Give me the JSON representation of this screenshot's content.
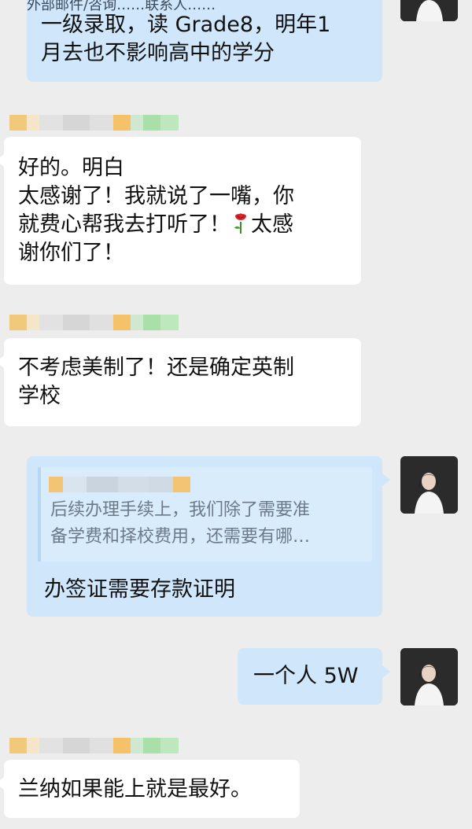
{
  "messages": {
    "m1": {
      "lines": [
        "一级录取，读 Grade8，明年1",
        "月去也不影响高中的学分"
      ],
      "top_fragment": "外部邮件/咨询……联系人……"
    },
    "m2": {
      "lines": [
        "好的。明白",
        "太感谢了！我就说了一嘴，你",
        "就费心帮我去打听了！",
        "谢你们了！"
      ],
      "line3_after_emoji": "太感",
      "emoji": "rose"
    },
    "m3": {
      "lines": [
        "不考虑美制了！还是确定英制",
        "学校"
      ]
    },
    "m4": {
      "quote_lines": [
        "后续办理手续上，我们除了需要准",
        "备学费和择校费用，还需要有哪…"
      ],
      "reply": "办签证需要存款证明"
    },
    "m5": {
      "text": "一个人 5W"
    },
    "m6": {
      "text": "兰纳如果能上就是最好。"
    }
  },
  "colors": {
    "background": "#ededed",
    "bubble_self": "#cfe6fb",
    "bubble_other": "#ffffff",
    "quote_bg": "#d9ecfc",
    "quote_text": "#6c7a88"
  },
  "icons": {
    "avatar": "user-avatar-photo",
    "rose": "rose-emoji"
  }
}
